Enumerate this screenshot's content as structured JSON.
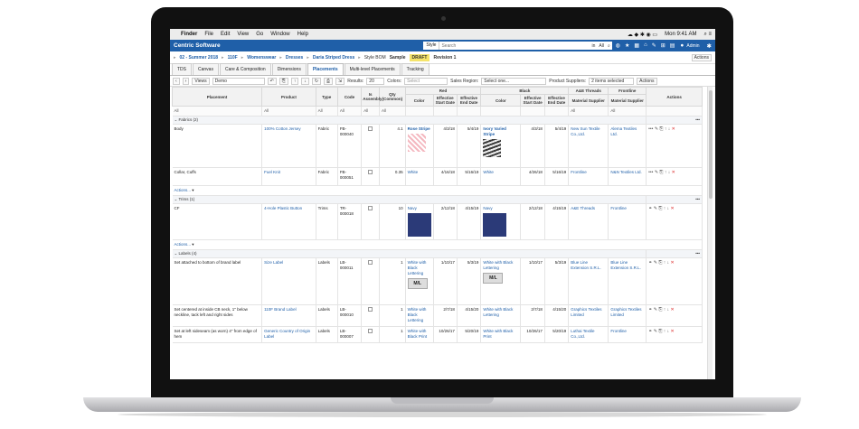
{
  "menubar": {
    "items": [
      "Finder",
      "File",
      "Edit",
      "View",
      "Go",
      "Window",
      "Help"
    ],
    "clock": "Mon 9:41 AM"
  },
  "app": {
    "brand": "Centric Software",
    "search_scope": "Style",
    "search_placeholder": "Search",
    "in_label": "in",
    "all_label": "All",
    "admin_label": "Admin"
  },
  "breadcrumb": {
    "items": [
      "02 - Summer 2018",
      "110F",
      "Womenswear",
      "Dresses",
      "Daria Striped Dress"
    ],
    "style_bom": "Style BOM",
    "sample": "Sample",
    "status": "DRAFT",
    "revision": "Revision 1",
    "actions": "Actions"
  },
  "tabs": [
    "TDS",
    "Canvas",
    "Care & Composition",
    "Dimensions",
    "Placements",
    "Multi-level Placements",
    "Tracking"
  ],
  "toolbar": {
    "views_label": "Views",
    "view_value": "Demo",
    "results_label": "Results:",
    "results_value": "20",
    "colors_label": "Colors:",
    "colors_placeholder": "Select",
    "sales_label": "Sales Region:",
    "sales_placeholder": "Select one...",
    "suppliers_label": "Product Suppliers:",
    "suppliers_value": "2 items selected",
    "actions_label": "Actions"
  },
  "columns": {
    "placement": "Placement",
    "product": "Product",
    "type": "Type",
    "code": "Code",
    "assembly": "Is Assembly",
    "qty": "Qty (Common)",
    "red": "Red",
    "black": "Black",
    "aethreads": "A&E Threads",
    "frontline": "Frontline",
    "actions": "Actions",
    "color": "Color",
    "eff_start": "Effective Start Date",
    "eff_end": "Effective End Date",
    "mat_supplier": "Material Supplier",
    "all": "All"
  },
  "groups": {
    "fabrics": "Fabrics (2)",
    "trims": "Trims (1)",
    "labels": "Labels (4)",
    "actions": "Actions..."
  },
  "rows": {
    "r1": {
      "placement": "Body",
      "product": "100% Cotton Jersey",
      "type": "Fabric",
      "code": "FB-000040",
      "qty": "4.1",
      "red_color": "Rose Stripe",
      "red_start": "4/3/18",
      "red_end": "5/4/19",
      "black_color": "Ivory Varied Stripe",
      "black_start": "4/3/18",
      "black_end": "5/4/19",
      "ae": "New Sun Textile Co.,Ltd.",
      "front": "Alema Textiles Ltd."
    },
    "r2": {
      "placement": "Collar, Cuffs",
      "product": "Fuel Knit",
      "type": "Fabric",
      "code": "FB-000051",
      "qty": "0.35",
      "red_color": "White",
      "red_start": "4/16/18",
      "red_end": "5/16/19",
      "black_color": "White",
      "black_start": "4/26/18",
      "black_end": "5/16/19",
      "ae": "Frontline",
      "front": "N&N Textiles Ltd."
    },
    "r3": {
      "placement": "CF",
      "product": "4-Hole Plastic Button",
      "type": "Trims",
      "code": "TR-000018",
      "qty": "10",
      "red_color": "Navy",
      "red_start": "2/12/18",
      "red_end": "4/15/19",
      "black_color": "Navy",
      "black_start": "2/12/18",
      "black_end": "4/15/19",
      "ae": "A&E Threads",
      "front": "Frontline"
    },
    "r4": {
      "placement": "Set attached to bottom of brand label",
      "product": "Size Label",
      "type": "Labels",
      "code": "LB-000011",
      "qty": "1",
      "red_color": "White with Black Lettering",
      "red_start": "1/10/17",
      "red_end": "5/3/19",
      "black_color": "White with Black Lettering",
      "black_start": "1/10/17",
      "black_end": "5/3/19",
      "ae": "Blue Line Extension S.R.L.",
      "front": "Blue Line Extension S.R.L.",
      "swatch": "M/L"
    },
    "r5": {
      "placement": "Set centered at inside CB neck, 1\" below neckline, tack left and right sides",
      "product": "110F Brand Label",
      "type": "Labels",
      "code": "LB-000010",
      "qty": "1",
      "red_color": "White with Black Lettering",
      "red_start": "2/7/18",
      "red_end": "4/15/20",
      "black_color": "White with Black Lettering",
      "black_start": "2/7/18",
      "black_end": "4/15/20",
      "ae": "Graphics Textiles Limited",
      "front": "Graphics Textiles Limited"
    },
    "r6": {
      "placement": "Set at left sideseam (as worn) 4\" from edge of hem",
      "product": "Generic Country of Origin Label",
      "type": "Labels",
      "code": "LB-000007",
      "qty": "1",
      "red_color": "White with Black Print",
      "red_start": "10/26/17",
      "red_end": "5/20/19",
      "black_color": "White with Black Print",
      "black_start": "10/26/17",
      "black_end": "5/20/19",
      "ae": "Luthai Textile Co.,Ltd.",
      "front": "Frontline"
    }
  },
  "colors": {
    "brand_blue": "#1f5fa8",
    "draft_yellow": "#f5e46a",
    "delete_red": "#dd3333"
  }
}
